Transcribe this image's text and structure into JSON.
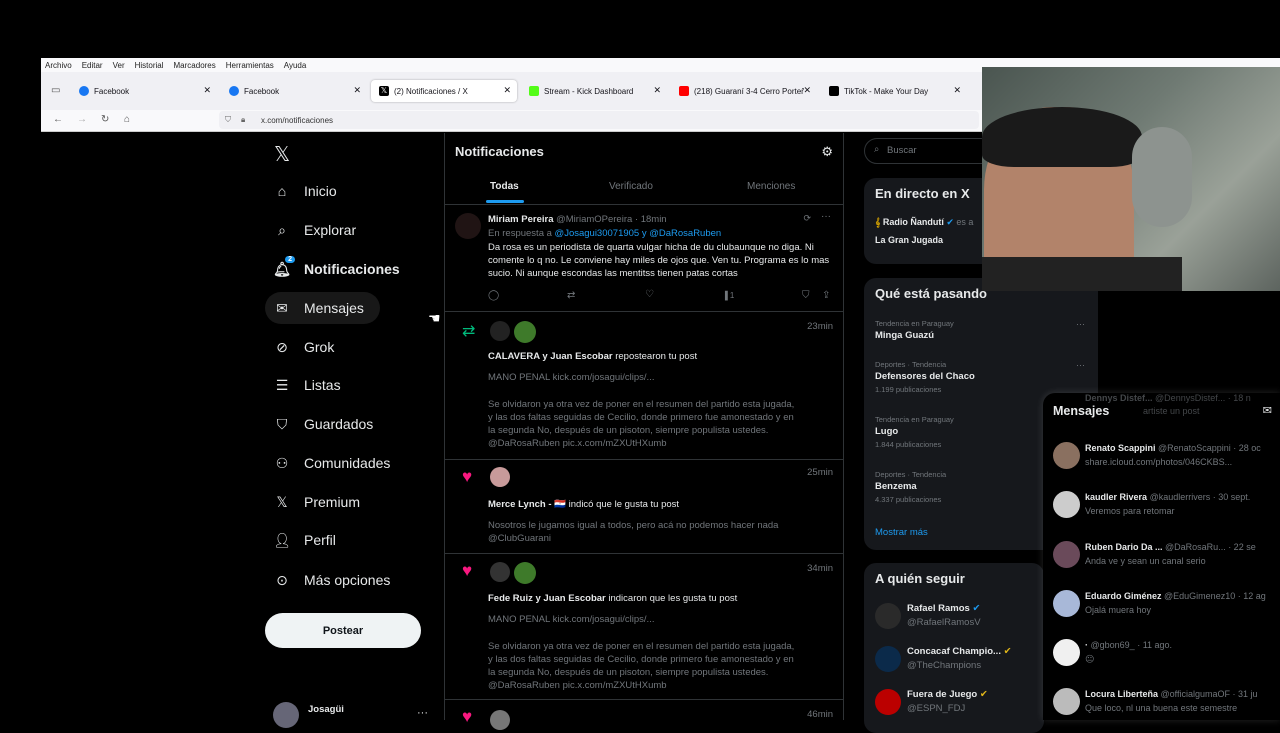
{
  "browser": {
    "menu": [
      "Archivo",
      "Editar",
      "Ver",
      "Historial",
      "Marcadores",
      "Herramientas",
      "Ayuda"
    ],
    "tabs": [
      {
        "label": "Facebook",
        "color": "#1877f2"
      },
      {
        "label": "Facebook",
        "color": "#1877f2"
      },
      {
        "label": "(2) Notificaciones / X",
        "color": "#000000"
      },
      {
        "label": "Stream - Kick Dashboard",
        "color": "#53fc18"
      },
      {
        "label": "(218) Guaraní 3-4 Cerro Porteñ",
        "color": "#ff0000"
      },
      {
        "label": "TikTok - Make Your Day",
        "color": "#000000"
      }
    ],
    "url": "x.com/notificaciones"
  },
  "nav": {
    "items": [
      "Inicio",
      "Explorar",
      "Notificaciones",
      "Mensajes",
      "Grok",
      "Listas",
      "Guardados",
      "Comunidades",
      "Premium",
      "Perfil",
      "Más opciones"
    ],
    "badge": "2",
    "post_label": "Postear",
    "account_name": "Josagüi"
  },
  "header": {
    "title": "Notificaciones",
    "tabs": [
      "Todas",
      "Verificado",
      "Menciones"
    ]
  },
  "notifications": [
    {
      "name": "Miriam Pereira",
      "handle": "@MiriamOPereira · 18min",
      "reply_to_prefix": "En respuesta a",
      "reply_to": "@Josagui30071905 y @DaRosaRuben",
      "text": "Da rosa es un periodista de quarta vulgar hicha de du clubaunque no diga. Ni comente lo q no. Le conviene  hay miles de ojos que. Ven tu. Programa es lo mas sucio. Ni aunque escondas las mentitss tienen patas cortas",
      "views": "1"
    },
    {
      "time": "23min",
      "actors": "CALAVERA y Juan Escobar",
      "action": "repostearon tu post",
      "line1": "MANO PENAL kick.com/josagui/clips/...",
      "body": "Se olvidaron ya otra vez de poner en el resumen del partido esta jugada, y las dos faltas seguidas de Cecilio, donde primero fue amonestado y en la segunda No, después de un pisoton, siempre populista ustedes. @DaRosaRuben pic.x.com/mZXUtHXumb"
    },
    {
      "time": "25min",
      "actors": "Merce Lynch - 🇵🇾",
      "action": "indicó que le gusta tu post",
      "body": "Nosotros le jugamos igual a todos, pero acá no podemos hacer nada @ClubGuarani"
    },
    {
      "time": "34min",
      "actors": "Fede Ruiz y Juan Escobar",
      "action": "indicaron que les gusta tu post",
      "line1": "MANO PENAL kick.com/josagui/clips/...",
      "body": "Se olvidaron ya otra vez de poner en el resumen del partido esta jugada, y las dos faltas seguidas de Cecilio, donde primero fue amonestado y en la segunda No, después de un pisoton, siempre populista ustedes. @DaRosaRuben pic.x.com/mZXUtHXumb"
    },
    {
      "time": "46min"
    }
  ],
  "right": {
    "search_placeholder": "Buscar",
    "live_title": "En directo en X",
    "live_user": "Radio Ñandutí",
    "live_suffix": "es a",
    "live_show": "La Gran Jugada",
    "trending_title": "Qué está pasando",
    "trends": [
      {
        "context": "Tendencia en Paraguay",
        "name": "Minga Guazú",
        "posts": ""
      },
      {
        "context": "Deportes · Tendencia",
        "name": "Defensores del Chaco",
        "posts": "1.199 publicaciones"
      },
      {
        "context": "Tendencia en Paraguay",
        "name": "Lugo",
        "posts": "1.844 publicaciones"
      },
      {
        "context": "Deportes · Tendencia",
        "name": "Benzema",
        "posts": "4.337 publicaciones"
      }
    ],
    "show_more": "Mostrar más",
    "follow_title": "A quién seguir",
    "follow": [
      {
        "name": "Rafael Ramos",
        "handle": "@RafaelRamosV"
      },
      {
        "name": "Concacaf Champio...",
        "handle": "@TheChampions"
      },
      {
        "name": "Fuera de Juego",
        "handle": "@ESPN_FDJ"
      }
    ]
  },
  "messages": {
    "title": "Mensajes",
    "ghost_name": "Dennys Distef...",
    "ghost_handle": "@DennysDistef...",
    "ghost_time": "18 n",
    "ghost_text": "artiste un post",
    "items": [
      {
        "name": "Renato Scappini",
        "meta": "@RenatoScappini · 28 oc",
        "text": "share.icloud.com/photos/046CKBS..."
      },
      {
        "name": "kaudler Rivera",
        "meta": "@kaudlerrivers · 30 sept.",
        "text": "Veremos para retomar"
      },
      {
        "name": "Ruben Dario Da ...",
        "meta": "@DaRosaRu... · 22 se",
        "text": "Anda ve y sean un canal serio"
      },
      {
        "name": "Eduardo Giménez",
        "meta": "@EduGimenez10 · 12 ag",
        "text": "Ojalá muera hoy"
      },
      {
        "name": "·",
        "meta": "@gbon69_ · 11 ago.",
        "text": "😐"
      },
      {
        "name": "Locura Liberteña",
        "meta": "@officialgumaOF · 31 ju",
        "text": "Que loco, nl una buena este semestre"
      }
    ]
  }
}
